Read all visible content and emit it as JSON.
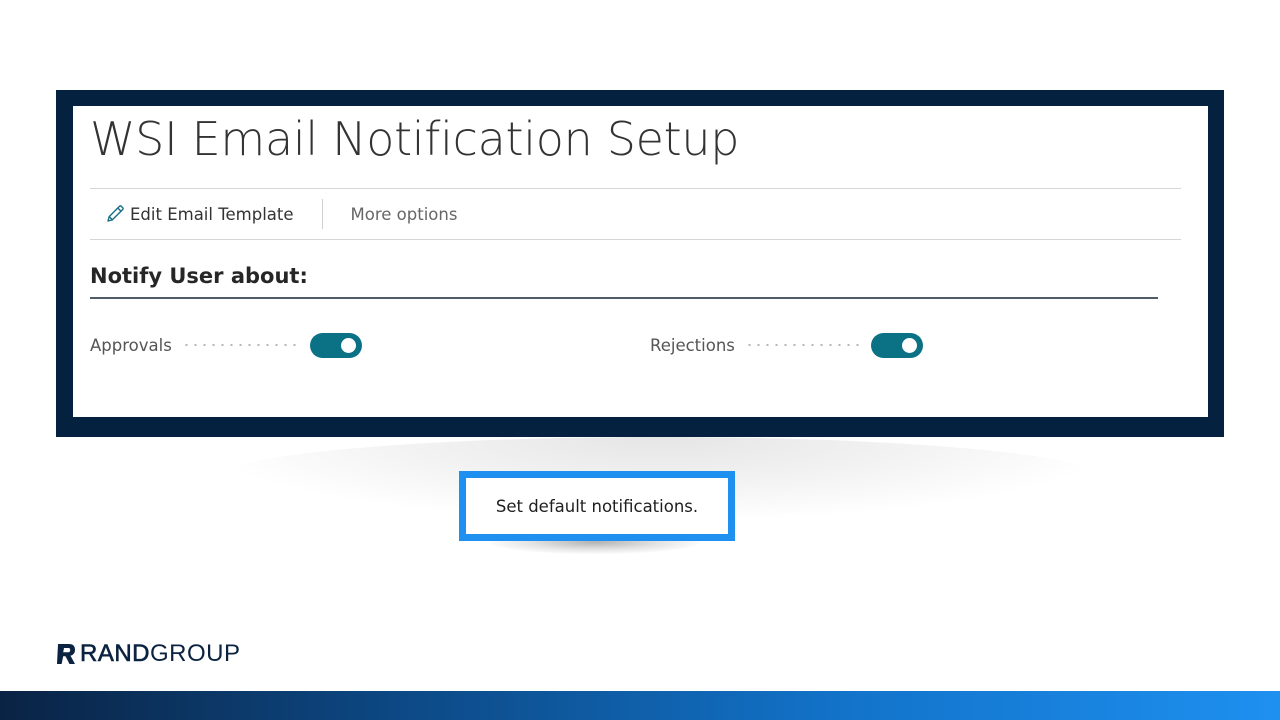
{
  "page": {
    "title": "WSI Email Notification Setup"
  },
  "actions": {
    "edit_template_label": "Edit Email Template",
    "more_options_label": "More options"
  },
  "section": {
    "title": "Notify User about:"
  },
  "fields": [
    {
      "label": "Approvals",
      "enabled": true
    },
    {
      "label": "Rejections",
      "enabled": true
    }
  ],
  "caption": {
    "text": "Set default notifications."
  },
  "brand": {
    "name_bold": "RAND",
    "name_light": "GROUP",
    "frame_color": "#04213f",
    "toggle_color": "#0b7285",
    "callout_border_color": "#1e90f0"
  },
  "icons": {
    "edit": "pencil-icon",
    "logo": "randgroup-logo-mark"
  }
}
